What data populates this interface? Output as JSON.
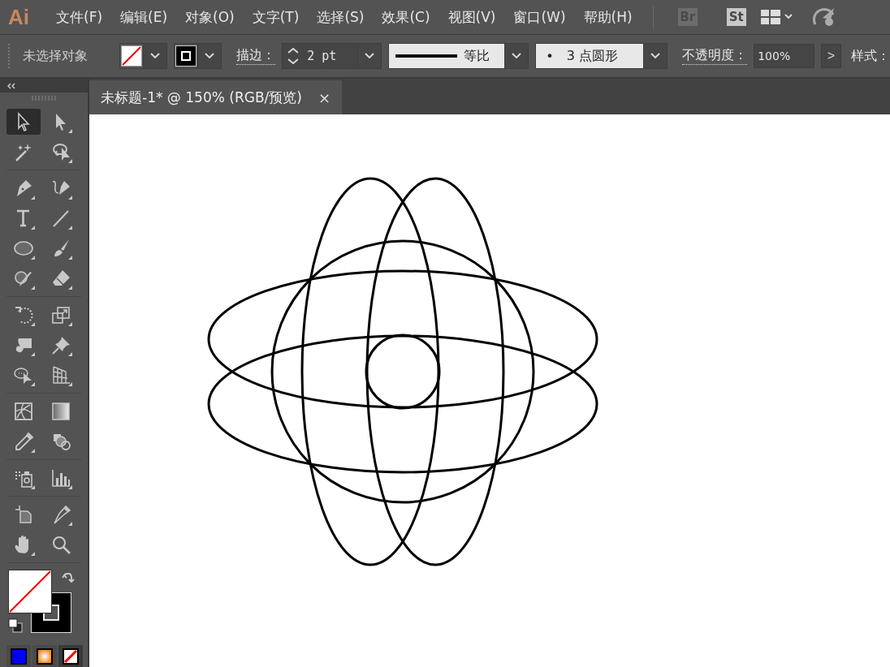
{
  "menu_bar": {
    "logo": "Ai",
    "menus": [
      "文件(F)",
      "编辑(E)",
      "对象(O)",
      "文字(T)",
      "选择(S)",
      "效果(C)",
      "视图(V)",
      "窗口(W)",
      "帮助(H)"
    ],
    "bridge": "Br",
    "stock": "St"
  },
  "control_bar": {
    "selection": "未选择对象",
    "stroke_label": "描边：",
    "stroke_weight": "2 pt",
    "stroke_profile": "等比",
    "brush_dot": "•",
    "brush": "3 点圆形",
    "opacity_label": "不透明度：",
    "opacity": "100%",
    "more": ">",
    "style_label": "样式："
  },
  "tab": {
    "title": "未标题-1* @ 150% (RGB/预览)",
    "close": "×",
    "selected": true
  },
  "tool_groups": [
    [
      {
        "selected": true
      },
      {
        "selected": false
      },
      {
        "selected": false
      },
      {
        "selected": false
      }
    ],
    [
      {
        "selected": false
      },
      {
        "selected": false
      },
      {
        "selected": false
      },
      {
        "selected": false
      },
      {
        "selected": false
      },
      {
        "selected": false
      },
      {
        "selected": false
      },
      {
        "selected": false
      }
    ],
    [
      {
        "selected": false
      },
      {
        "selected": false
      },
      {
        "selected": false
      },
      {
        "selected": false
      },
      {
        "selected": false
      },
      {
        "selected": false
      }
    ],
    [
      {
        "selected": false
      },
      {
        "selected": false
      },
      {
        "selected": false
      },
      {
        "selected": false
      }
    ],
    [
      {
        "selected": false
      },
      {
        "selected": false
      }
    ],
    [
      {
        "selected": false
      },
      {
        "selected": false
      },
      {
        "selected": false
      },
      {
        "selected": false
      }
    ]
  ],
  "color_modes": [
    {
      "selected": false
    },
    {
      "selected": false
    },
    {
      "selected": true
    }
  ]
}
